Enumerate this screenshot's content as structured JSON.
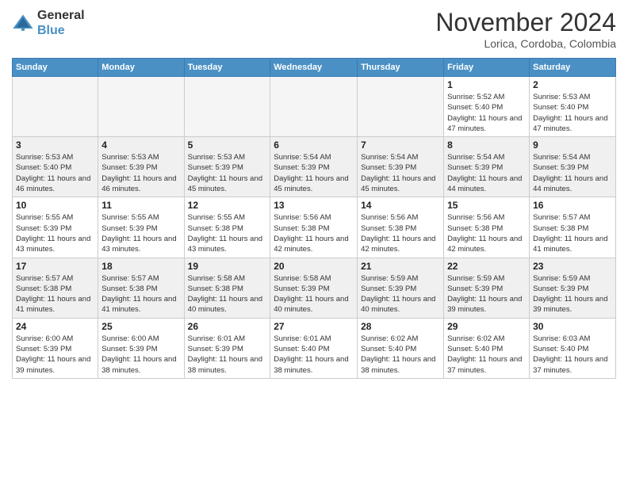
{
  "header": {
    "logo_line1": "General",
    "logo_line2": "Blue",
    "month": "November 2024",
    "location": "Lorica, Cordoba, Colombia"
  },
  "weekdays": [
    "Sunday",
    "Monday",
    "Tuesday",
    "Wednesday",
    "Thursday",
    "Friday",
    "Saturday"
  ],
  "weeks": [
    [
      {
        "day": "",
        "info": ""
      },
      {
        "day": "",
        "info": ""
      },
      {
        "day": "",
        "info": ""
      },
      {
        "day": "",
        "info": ""
      },
      {
        "day": "",
        "info": ""
      },
      {
        "day": "1",
        "info": "Sunrise: 5:52 AM\nSunset: 5:40 PM\nDaylight: 11 hours and 47 minutes."
      },
      {
        "day": "2",
        "info": "Sunrise: 5:53 AM\nSunset: 5:40 PM\nDaylight: 11 hours and 47 minutes."
      }
    ],
    [
      {
        "day": "3",
        "info": "Sunrise: 5:53 AM\nSunset: 5:40 PM\nDaylight: 11 hours and 46 minutes."
      },
      {
        "day": "4",
        "info": "Sunrise: 5:53 AM\nSunset: 5:39 PM\nDaylight: 11 hours and 46 minutes."
      },
      {
        "day": "5",
        "info": "Sunrise: 5:53 AM\nSunset: 5:39 PM\nDaylight: 11 hours and 45 minutes."
      },
      {
        "day": "6",
        "info": "Sunrise: 5:54 AM\nSunset: 5:39 PM\nDaylight: 11 hours and 45 minutes."
      },
      {
        "day": "7",
        "info": "Sunrise: 5:54 AM\nSunset: 5:39 PM\nDaylight: 11 hours and 45 minutes."
      },
      {
        "day": "8",
        "info": "Sunrise: 5:54 AM\nSunset: 5:39 PM\nDaylight: 11 hours and 44 minutes."
      },
      {
        "day": "9",
        "info": "Sunrise: 5:54 AM\nSunset: 5:39 PM\nDaylight: 11 hours and 44 minutes."
      }
    ],
    [
      {
        "day": "10",
        "info": "Sunrise: 5:55 AM\nSunset: 5:39 PM\nDaylight: 11 hours and 43 minutes."
      },
      {
        "day": "11",
        "info": "Sunrise: 5:55 AM\nSunset: 5:39 PM\nDaylight: 11 hours and 43 minutes."
      },
      {
        "day": "12",
        "info": "Sunrise: 5:55 AM\nSunset: 5:38 PM\nDaylight: 11 hours and 43 minutes."
      },
      {
        "day": "13",
        "info": "Sunrise: 5:56 AM\nSunset: 5:38 PM\nDaylight: 11 hours and 42 minutes."
      },
      {
        "day": "14",
        "info": "Sunrise: 5:56 AM\nSunset: 5:38 PM\nDaylight: 11 hours and 42 minutes."
      },
      {
        "day": "15",
        "info": "Sunrise: 5:56 AM\nSunset: 5:38 PM\nDaylight: 11 hours and 42 minutes."
      },
      {
        "day": "16",
        "info": "Sunrise: 5:57 AM\nSunset: 5:38 PM\nDaylight: 11 hours and 41 minutes."
      }
    ],
    [
      {
        "day": "17",
        "info": "Sunrise: 5:57 AM\nSunset: 5:38 PM\nDaylight: 11 hours and 41 minutes."
      },
      {
        "day": "18",
        "info": "Sunrise: 5:57 AM\nSunset: 5:38 PM\nDaylight: 11 hours and 41 minutes."
      },
      {
        "day": "19",
        "info": "Sunrise: 5:58 AM\nSunset: 5:38 PM\nDaylight: 11 hours and 40 minutes."
      },
      {
        "day": "20",
        "info": "Sunrise: 5:58 AM\nSunset: 5:39 PM\nDaylight: 11 hours and 40 minutes."
      },
      {
        "day": "21",
        "info": "Sunrise: 5:59 AM\nSunset: 5:39 PM\nDaylight: 11 hours and 40 minutes."
      },
      {
        "day": "22",
        "info": "Sunrise: 5:59 AM\nSunset: 5:39 PM\nDaylight: 11 hours and 39 minutes."
      },
      {
        "day": "23",
        "info": "Sunrise: 5:59 AM\nSunset: 5:39 PM\nDaylight: 11 hours and 39 minutes."
      }
    ],
    [
      {
        "day": "24",
        "info": "Sunrise: 6:00 AM\nSunset: 5:39 PM\nDaylight: 11 hours and 39 minutes."
      },
      {
        "day": "25",
        "info": "Sunrise: 6:00 AM\nSunset: 5:39 PM\nDaylight: 11 hours and 38 minutes."
      },
      {
        "day": "26",
        "info": "Sunrise: 6:01 AM\nSunset: 5:39 PM\nDaylight: 11 hours and 38 minutes."
      },
      {
        "day": "27",
        "info": "Sunrise: 6:01 AM\nSunset: 5:40 PM\nDaylight: 11 hours and 38 minutes."
      },
      {
        "day": "28",
        "info": "Sunrise: 6:02 AM\nSunset: 5:40 PM\nDaylight: 11 hours and 38 minutes."
      },
      {
        "day": "29",
        "info": "Sunrise: 6:02 AM\nSunset: 5:40 PM\nDaylight: 11 hours and 37 minutes."
      },
      {
        "day": "30",
        "info": "Sunrise: 6:03 AM\nSunset: 5:40 PM\nDaylight: 11 hours and 37 minutes."
      }
    ]
  ]
}
